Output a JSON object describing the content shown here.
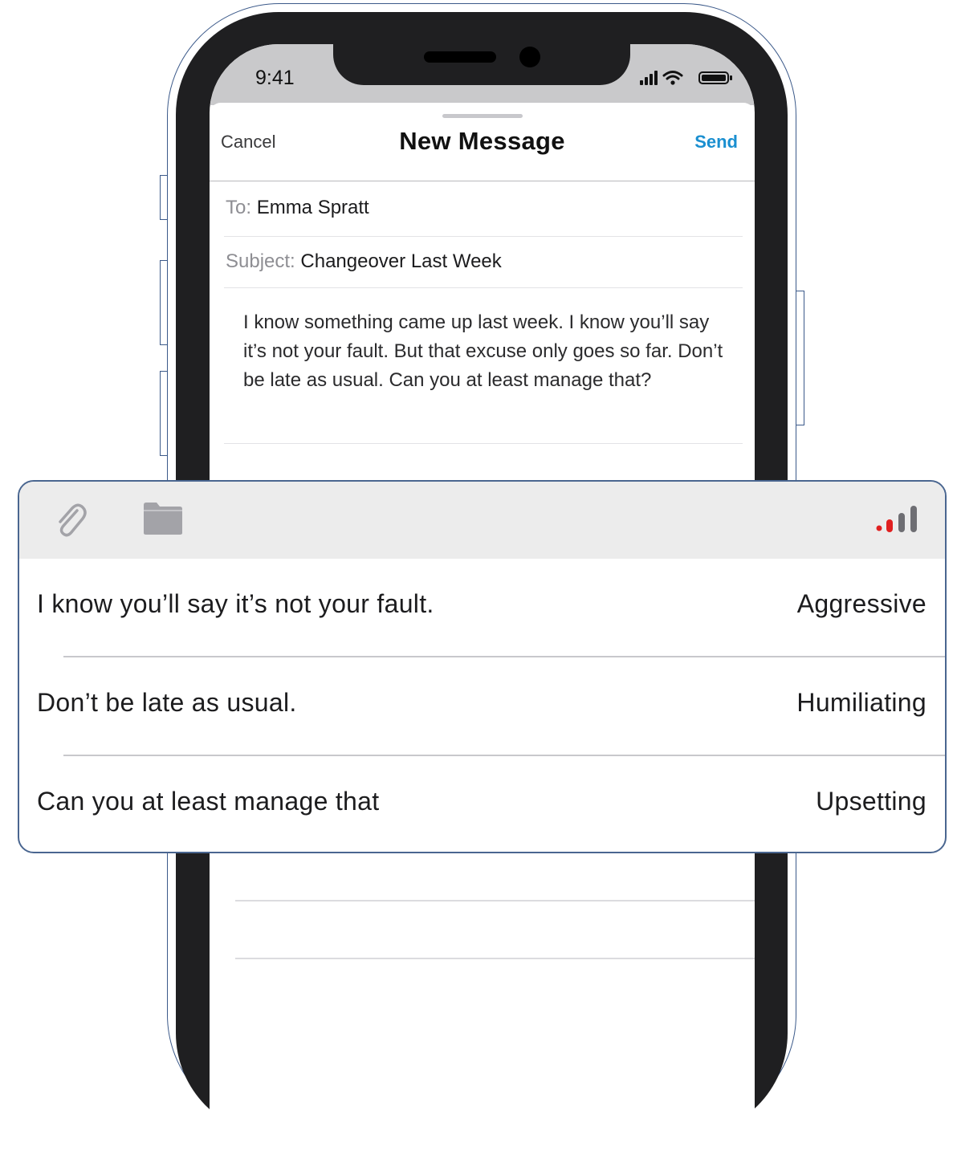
{
  "status_bar": {
    "time": "9:41"
  },
  "compose": {
    "cancel_label": "Cancel",
    "title": "New Message",
    "send_label": "Send",
    "to_label": "To:",
    "to_value": "Emma Spratt",
    "subject_label": "Subject:",
    "subject_value": "Changeover Last Week",
    "body_text": "I know something came up last week. I know you’ll say it’s not your fault. But that excuse only goes so far. Don’t be late as usual. Can you at least manage that?"
  },
  "analysis_panel": {
    "toolbar_icons": [
      "paperclip-icon",
      "folder-icon",
      "tone-meter-icon"
    ],
    "tone_meter_colors": {
      "active": "#e02020",
      "bars": "#6e6e73"
    },
    "flags": [
      {
        "phrase": "I know you’ll say it’s not your fault.",
        "tone": "Aggressive"
      },
      {
        "phrase": "Don’t be late as usual.",
        "tone": "Humiliating"
      },
      {
        "phrase": "Can you at least manage that",
        "tone": "Upsetting"
      }
    ]
  },
  "colors": {
    "send": "#1a8fd0",
    "frame": "#1f1f21",
    "outline": "#3c5a8a"
  }
}
